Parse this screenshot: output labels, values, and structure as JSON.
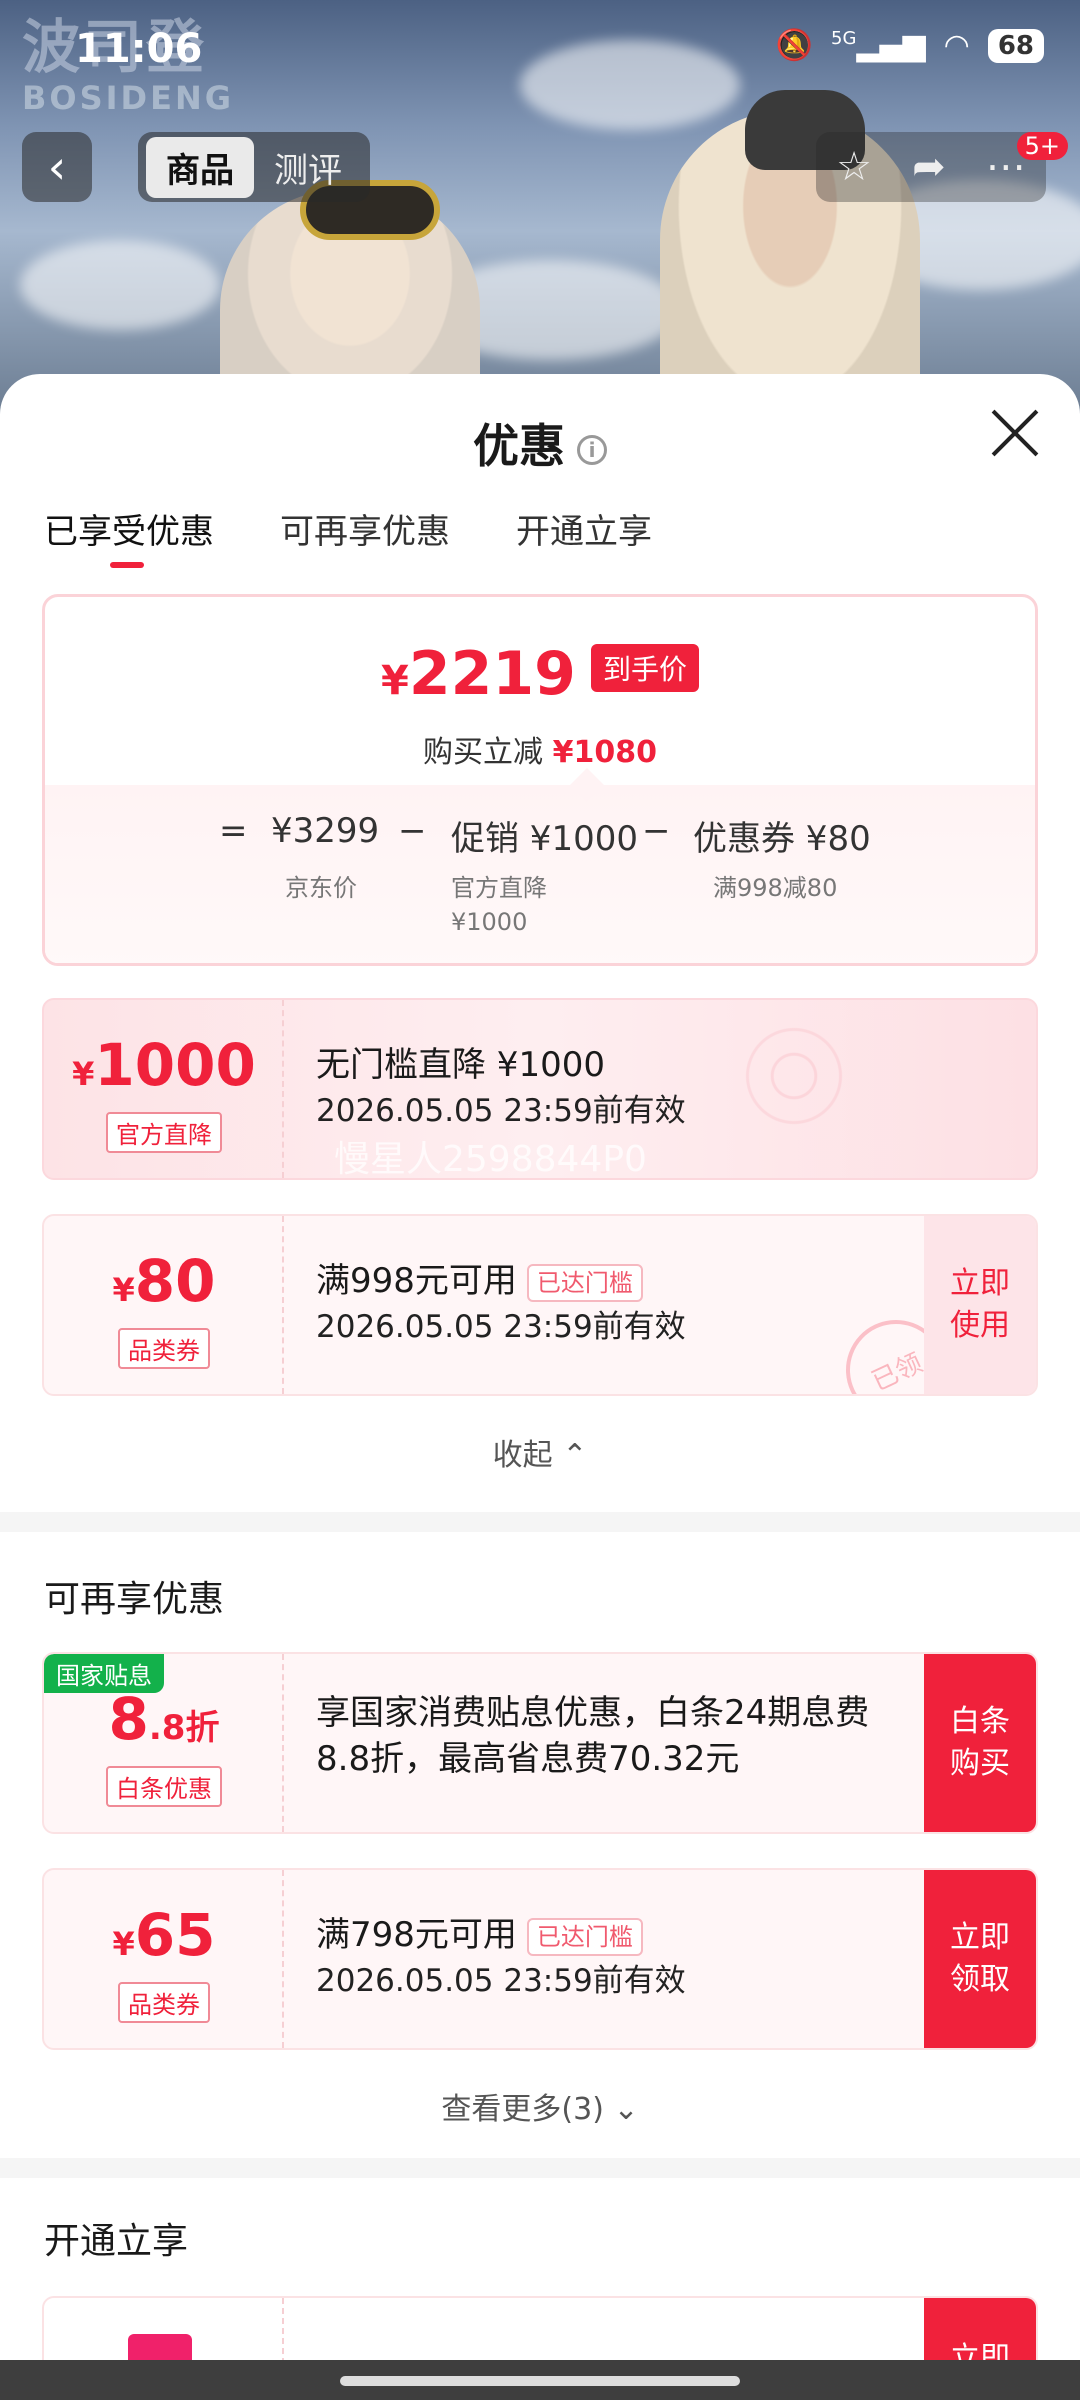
{
  "status_bar": {
    "time": "11:06",
    "network": "5G",
    "battery": "68"
  },
  "brand": {
    "name_cn": "波司登",
    "name_en": "BOSIDENG"
  },
  "top_nav": {
    "tabs": [
      "商品",
      "测评"
    ],
    "active_tab": "商品",
    "badge": "5+"
  },
  "sheet": {
    "title": "优惠",
    "tabs": [
      "已享受优惠",
      "可再享优惠",
      "开通立享"
    ],
    "active_tab": "已享受优惠"
  },
  "summary": {
    "final_price": "2219",
    "currency": "¥",
    "final_tag": "到手价",
    "save_label": "购买立减",
    "save_amount": "¥1080",
    "calc": {
      "equals": "=",
      "base": "¥3299",
      "base_label": "京东价",
      "minus1": "−",
      "promo": "促销 ¥1000",
      "promo_label_1": "官方直降",
      "promo_label_2": "¥1000",
      "minus2": "−",
      "coupon": "优惠券 ¥80",
      "coupon_label": "满998减80"
    }
  },
  "applied_coupons": [
    {
      "amount": "1000",
      "tag": "官方直降",
      "title": "无门槛直降 ¥1000",
      "valid": "2026.05.05 23:59前有效",
      "watermark": "慢星人2598844P0"
    },
    {
      "amount": "80",
      "tag": "品类券",
      "title": "满998元可用",
      "threshold": "已达门槛",
      "valid": "2026.05.05 23:59前有效",
      "action": "立即使用",
      "stamp": "已领"
    }
  ],
  "collapse_label": "收起",
  "more_section": {
    "title": "可再享优惠",
    "items": [
      {
        "badge": "国家贴息",
        "amount_big": "8",
        "amount_small": ".8折",
        "tag": "白条优惠",
        "line1": "享国家消费贴息优惠，白条24期息费",
        "line2": "8.8折，最高省息费70.32元",
        "action": "白条购买"
      },
      {
        "amount": "65",
        "tag": "品类券",
        "title": "满798元可用",
        "threshold": "已达门槛",
        "valid": "2026.05.05 23:59前有效",
        "action": "立即领取"
      }
    ],
    "see_more": "查看更多(3)"
  },
  "open_section": {
    "title": "开通立享",
    "action_partial": "立即"
  },
  "colors": {
    "accent": "#f0213b",
    "green_badge": "#13b14b"
  }
}
